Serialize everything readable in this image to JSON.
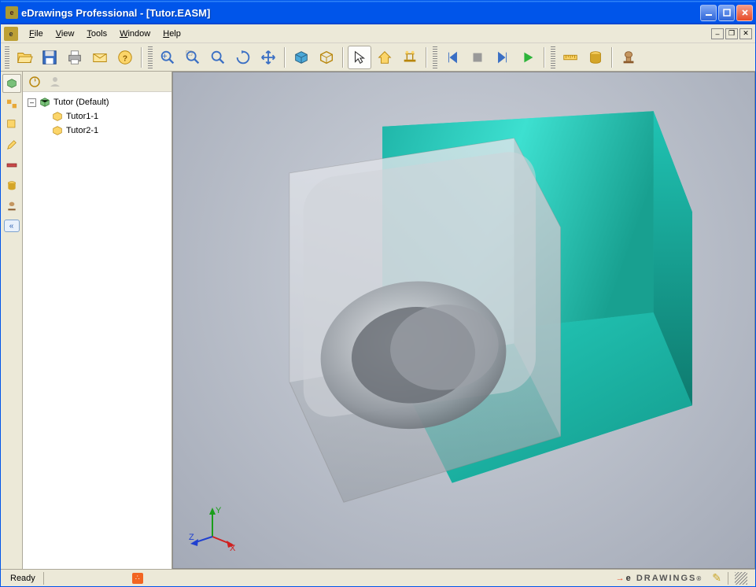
{
  "titlebar": {
    "title": "eDrawings Professional - [Tutor.EASM]"
  },
  "menubar": {
    "file": "File",
    "view": "View",
    "tools": "Tools",
    "window": "Window",
    "help": "Help"
  },
  "tree": {
    "root": "Tutor (Default)",
    "children": [
      "Tutor1-1",
      "Tutor2-1"
    ]
  },
  "status": {
    "ready": "Ready",
    "brand": "DRAWINGS"
  },
  "triad": {
    "x": "X",
    "y": "Y",
    "z": "Z"
  }
}
